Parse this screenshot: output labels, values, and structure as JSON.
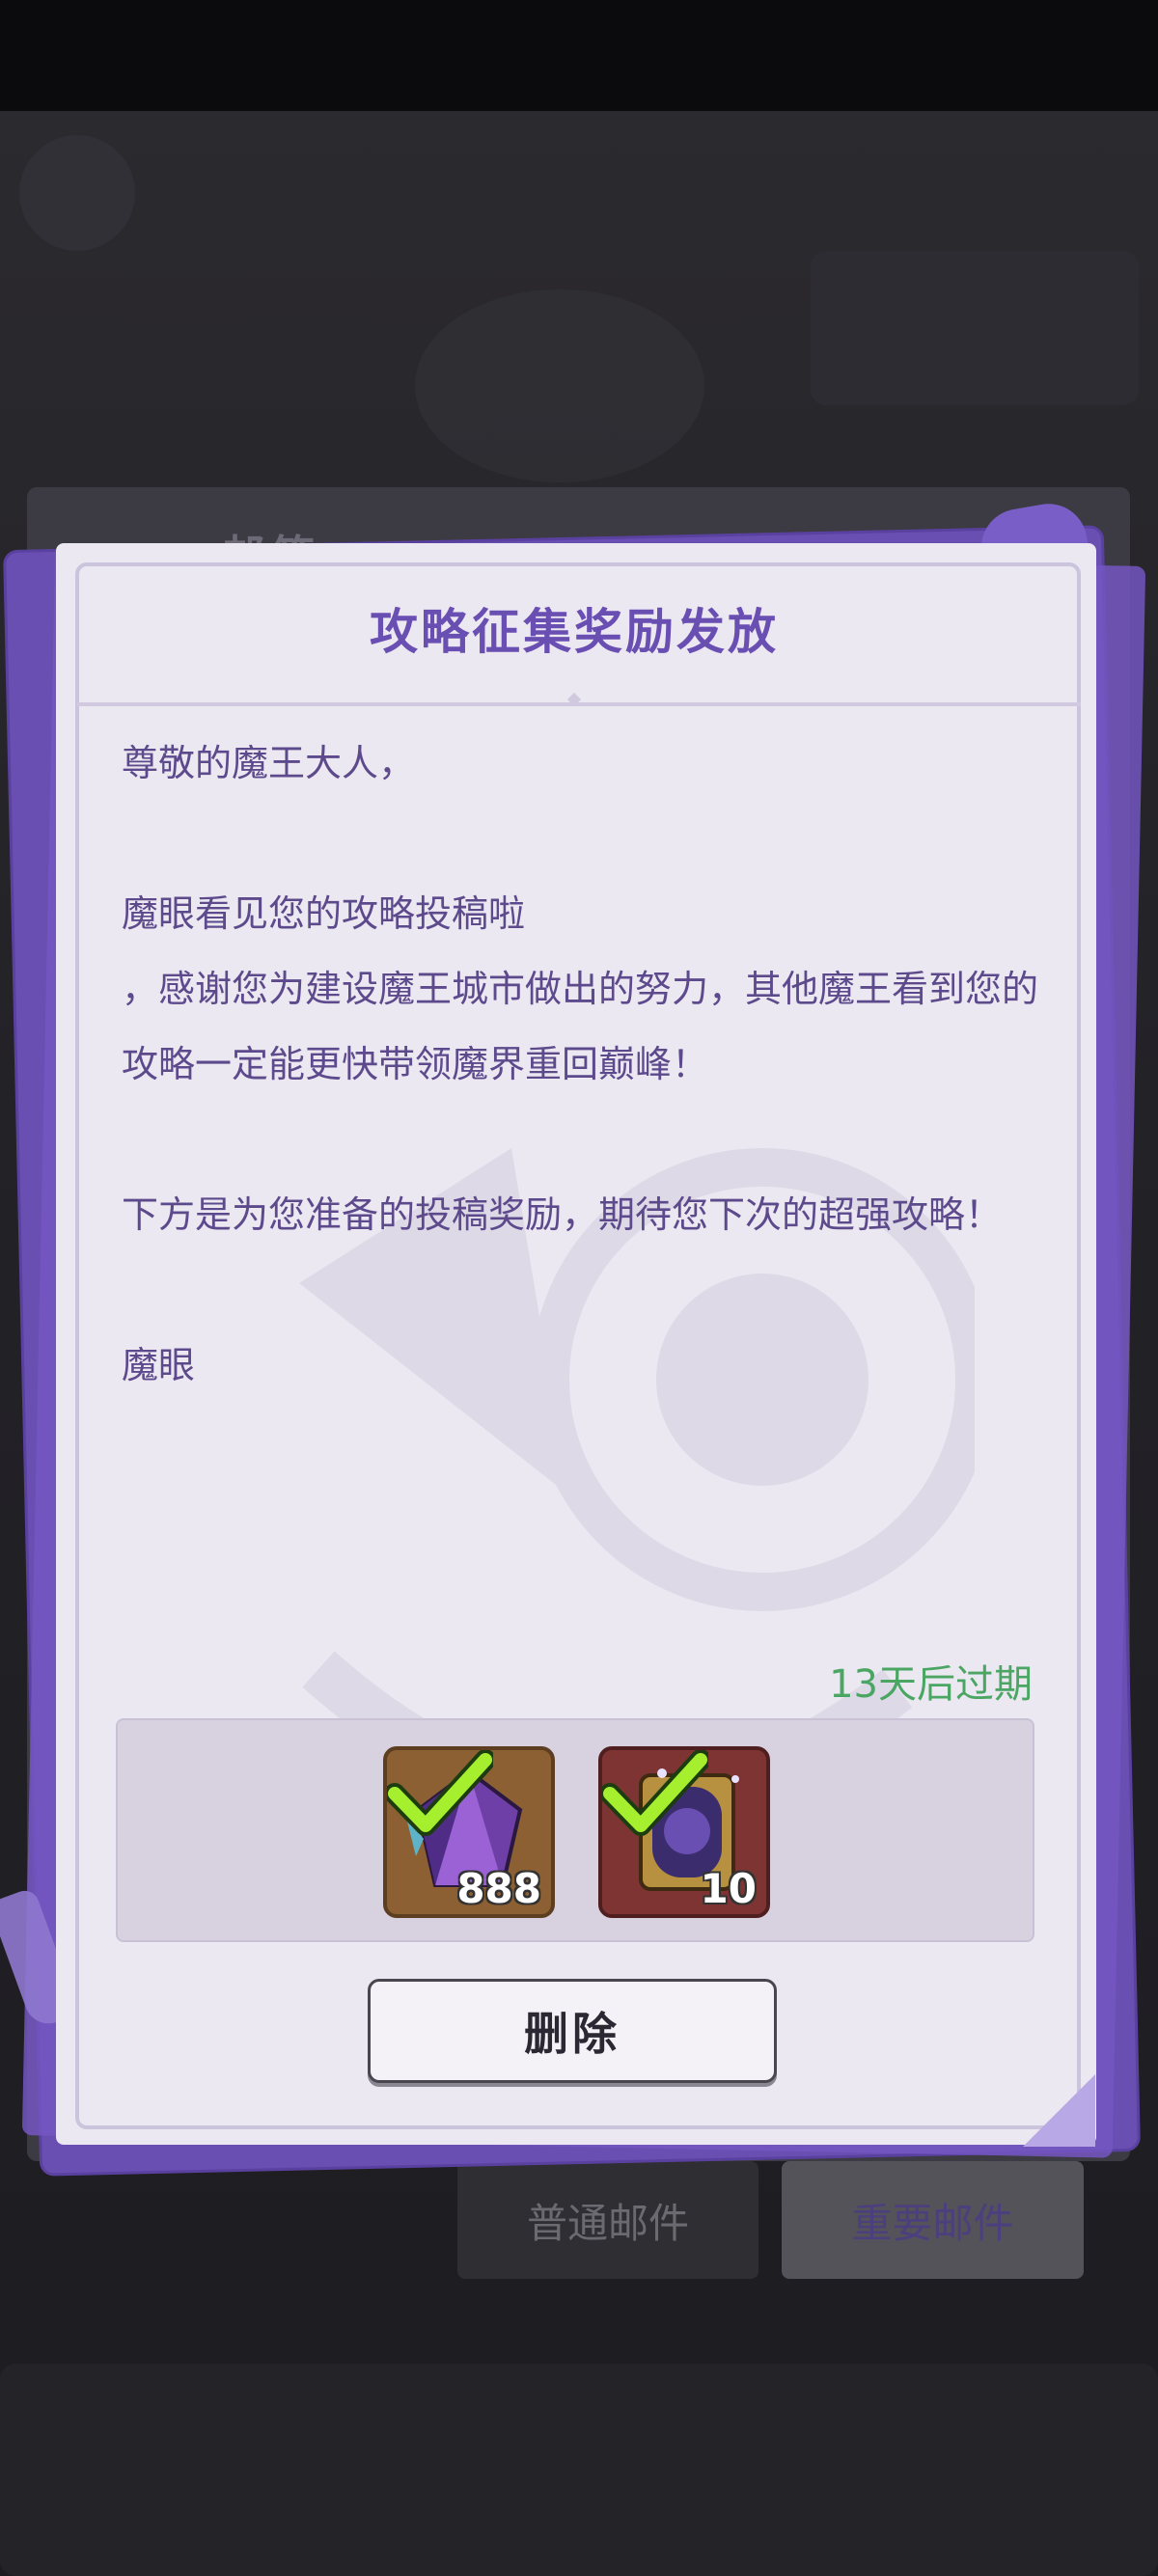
{
  "mailbox": {
    "title": "邮箱",
    "tabs": [
      {
        "label": "普通邮件",
        "selected": false
      },
      {
        "label": "重要邮件",
        "selected": true
      }
    ]
  },
  "letter": {
    "title": "攻略征集奖励发放",
    "body": "尊敬的魔王大人，\n\n魔眼看见您的攻略投稿啦\n，感谢您为建设魔王城市做出的努力，其他魔王看到您的攻略一定能更快带领魔界重回巅峰！\n\n下方是为您准备的投稿奖励，期待您下次的超强攻略！\n\n魔眼",
    "expiry": "13天后过期",
    "rewards": [
      {
        "icon": "crystal-icon",
        "count": "888",
        "claimed": true
      },
      {
        "icon": "tome-icon",
        "count": "10",
        "claimed": true
      }
    ],
    "delete_label": "删除"
  },
  "colors": {
    "accent": "#6a4fb3",
    "expiry": "#4aa662",
    "paper": "#ece8f1"
  }
}
